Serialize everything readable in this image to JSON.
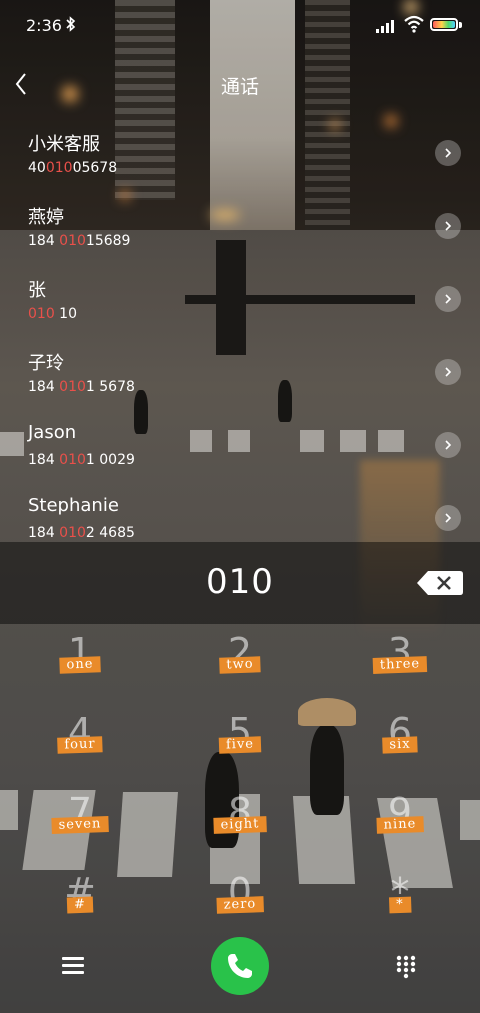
{
  "status_bar": {
    "time": "2:36",
    "bluetooth": "bluetooth-icon"
  },
  "header": {
    "title": "通话",
    "back_icon": "chevron-left-icon"
  },
  "contacts": [
    {
      "name": "小米客服",
      "num_pre": "40",
      "num_hl": "010",
      "num_post": "05678"
    },
    {
      "name": "燕婷",
      "num_pre": "184 ",
      "num_hl": "010",
      "num_post": "15689"
    },
    {
      "name": "张",
      "num_pre": "",
      "num_hl": "010",
      "num_post": " 10"
    },
    {
      "name": "子玲",
      "num_pre": "184 ",
      "num_hl": "010",
      "num_post": "1 5678"
    },
    {
      "name": "Jason",
      "num_pre": "184 ",
      "num_hl": "010",
      "num_post": "1 0029"
    },
    {
      "name": "Stephanie",
      "num_pre": "184 ",
      "num_hl": "010",
      "num_post": "2 4685"
    }
  ],
  "colors": {
    "highlight": "#e9504a",
    "key_label": "#e98b2a",
    "call": "#29c24a"
  },
  "display": {
    "digits": "010"
  },
  "keypad": [
    {
      "digit": "1",
      "label": "one"
    },
    {
      "digit": "2",
      "label": "two"
    },
    {
      "digit": "3",
      "label": "three"
    },
    {
      "digit": "4",
      "label": "four"
    },
    {
      "digit": "5",
      "label": "five"
    },
    {
      "digit": "6",
      "label": "six"
    },
    {
      "digit": "7",
      "label": "seven"
    },
    {
      "digit": "8",
      "label": "eight"
    },
    {
      "digit": "9",
      "label": "nine"
    },
    {
      "digit": "#",
      "label": "#"
    },
    {
      "digit": "0",
      "label": "zero"
    },
    {
      "digit": "*",
      "label": "*"
    }
  ],
  "bottom_bar": {
    "menu_icon": "menu-icon",
    "call_icon": "phone-icon",
    "keypad_icon": "keypad-dots-icon"
  }
}
